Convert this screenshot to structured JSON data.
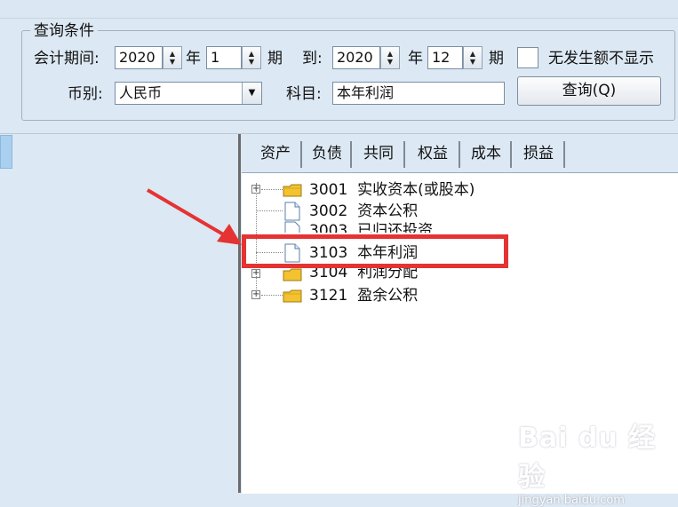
{
  "query_group": {
    "title": "查询条件",
    "period_label": "会计期间:",
    "start_year": "2020",
    "year_unit": "年",
    "start_period": "1",
    "period_unit": "期",
    "to_label": "到:",
    "end_year": "2020",
    "end_period": "12",
    "hide_no_amount_label": "无发生额不显示",
    "currency_label": "币别:",
    "currency_value": "人民币",
    "subject_label": "科目:",
    "subject_value": "本年利润",
    "query_button": "查询(Q)"
  },
  "tabs": [
    {
      "label": "资产",
      "active": false
    },
    {
      "label": "负债",
      "active": false
    },
    {
      "label": "共同",
      "active": false
    },
    {
      "label": "权益",
      "active": true
    },
    {
      "label": "成本",
      "active": false
    },
    {
      "label": "损益",
      "active": false
    }
  ],
  "tree_items": [
    {
      "code": "3001",
      "name": "实收资本(或股本)",
      "type": "folder",
      "expandable": true
    },
    {
      "code": "3002",
      "name": "资本公积",
      "type": "doc",
      "expandable": false
    },
    {
      "code": "3003",
      "name": "已归还投资",
      "type": "doc",
      "expandable": false
    },
    {
      "code": "3103",
      "name": "本年利润",
      "type": "doc",
      "expandable": false
    },
    {
      "code": "3104",
      "name": "利润分配",
      "type": "folder",
      "expandable": true
    },
    {
      "code": "3121",
      "name": "盈余公积",
      "type": "folder",
      "expandable": true
    }
  ],
  "icons": {
    "folder": "folder-icon",
    "document": "document-icon",
    "expand": "plus-box-icon",
    "spin": "spin-updown-icon",
    "dropdown": "chevron-down-icon"
  },
  "colors": {
    "background": "#dce8f3",
    "highlight": "#e53333",
    "folder": "#f2c230"
  },
  "watermark": {
    "logo": "Bai du 经验",
    "url": "jingyan.baidu.com"
  }
}
